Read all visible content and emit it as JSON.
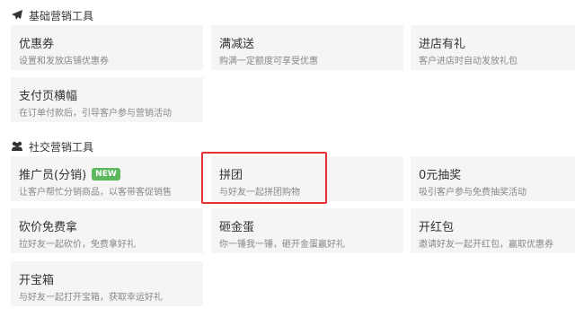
{
  "sections": [
    {
      "title": "基础营销工具",
      "icon": "paper-plane-icon"
    },
    {
      "title": "社交营销工具",
      "icon": "users-icon"
    }
  ],
  "basic_tools": [
    {
      "title": "优惠券",
      "desc": "设置和发放店铺优惠券"
    },
    {
      "title": "满减送",
      "desc": "购满一定额度可享受优惠"
    },
    {
      "title": "进店有礼",
      "desc": "客户进店时自动发放礼包"
    },
    {
      "title": "支付页横幅",
      "desc": "在订单付款后，引导客户参与营销活动"
    }
  ],
  "social_tools": [
    {
      "title": "推广员(分销)",
      "desc": "让客户帮忙分销商品，以客带客促销售",
      "badge": "NEW"
    },
    {
      "title": "拼团",
      "desc": "与好友一起拼团购物"
    },
    {
      "title": "0元抽奖",
      "desc": "吸引客户参与免费抽奖活动"
    },
    {
      "title": "砍价免费拿",
      "desc": "拉好友一起砍价，免费拿好礼"
    },
    {
      "title": "砸金蛋",
      "desc": "你一锤我一锤，砸开金蛋赢好礼"
    },
    {
      "title": "开红包",
      "desc": "邀请好友一起开红包，赢取优惠券"
    },
    {
      "title": "开宝箱",
      "desc": "与好友一起打开宝箱，获取幸运好礼"
    }
  ],
  "colors": {
    "highlight": "#e53333",
    "badge": "#5cb85c",
    "card_bg": "#f5f5f5"
  }
}
